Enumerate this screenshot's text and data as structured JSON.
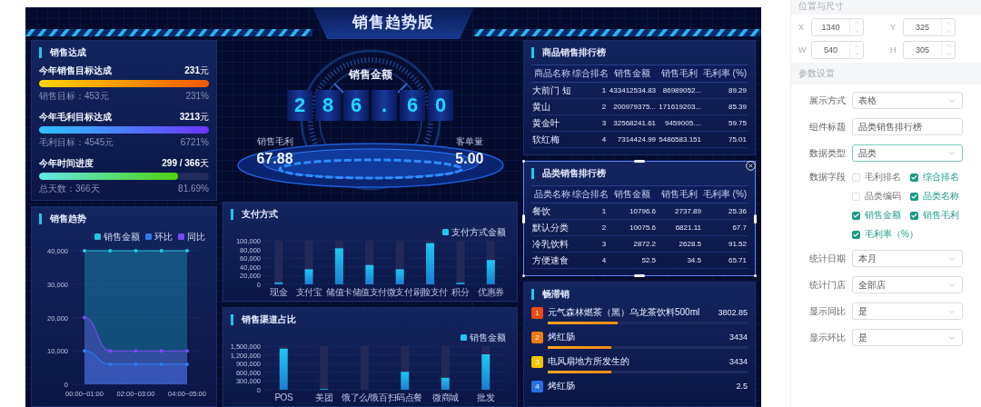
{
  "header": {
    "title": "销售趋势版"
  },
  "achievement": {
    "title": "销售达成",
    "items": [
      {
        "label": "今年销售目标达成",
        "value": "231",
        "unit": "元",
        "level": 1,
        "target": "销售目标：453元",
        "percent": "231%"
      },
      {
        "label": "今年毛利目标达成",
        "value": "3213",
        "unit": "元",
        "level": 1,
        "target": "毛利目标：4545元",
        "percent": "6721%"
      },
      {
        "label": "今年时间进度",
        "value": "299 / 366",
        "unit": "天",
        "level": 0.8169,
        "target": "总天数：366天",
        "percent": "81.69%"
      }
    ]
  },
  "trend": {
    "title": "销售趋势",
    "chart_data": {
      "type": "area",
      "categories": [
        "00:00~01:00",
        null,
        "02:00~03:00",
        null,
        "04:00~05:00"
      ],
      "grid": true,
      "legend": "upper right",
      "ylim": [
        0,
        40000
      ],
      "yticks": [
        {
          "value": 0,
          "label": "0"
        },
        {
          "value": 10000,
          "label": "10,000"
        },
        {
          "value": 20000,
          "label": "20,000"
        },
        {
          "value": 30000,
          "label": "30,000"
        },
        {
          "value": 40000,
          "label": "40,000"
        }
      ],
      "series": [
        {
          "name": "销售金额",
          "color": "#22c7e0",
          "values": [
            40000,
            40000,
            40000,
            40000,
            40000
          ]
        },
        {
          "name": "环比",
          "color": "#2a7bf0",
          "values": [
            10000,
            6000,
            6000,
            6000,
            6000
          ]
        },
        {
          "name": "同比",
          "color": "#7a4cf0",
          "values": [
            20000,
            10000,
            10000,
            10000,
            10000
          ]
        }
      ]
    }
  },
  "sales_amount": {
    "label": "销售金额",
    "digits": [
      "2",
      "8",
      "6",
      ".",
      "6",
      "0"
    ],
    "stats": [
      {
        "label": "销售毛利",
        "value": "67.88"
      },
      {
        "label": "客单量",
        "value": "5.00"
      }
    ]
  },
  "payment": {
    "title": "支付方式",
    "chart_data": {
      "type": "bar",
      "categories": [
        "现金",
        "支付宝",
        "储值卡",
        "储值支付",
        "微支付",
        "刷脸支付",
        "积分",
        "优惠券"
      ],
      "grid": true,
      "legend": "upper right",
      "ylim": [
        0,
        100000
      ],
      "yticks": [
        {
          "value": 0,
          "label": "0"
        },
        {
          "value": 20000,
          "label": "20,000"
        },
        {
          "value": 40000,
          "label": "40,000"
        },
        {
          "value": 60000,
          "label": "60,000"
        },
        {
          "value": 80000,
          "label": "80,000"
        },
        {
          "value": 100000,
          "label": "100,000"
        }
      ],
      "series": [
        {
          "name": "支付方式金额",
          "color": "#1fc8f0",
          "values": [
            5000,
            35000,
            83000,
            45000,
            35000,
            95000,
            4000,
            56000
          ]
        },
        {
          "color": "#25295a",
          "values": [
            95000,
            65000,
            17000,
            55000,
            65000,
            5000,
            96000,
            44000
          ]
        }
      ],
      "stacked": true
    }
  },
  "channels": {
    "title": "销售渠道占比",
    "chart_data": {
      "type": "bar",
      "categories": [
        "POS",
        "美团",
        "饿了么/饿百",
        "扫码点餐",
        "微商城",
        "批发"
      ],
      "grid": true,
      "legend": "upper right",
      "ylim": [
        0,
        1500000
      ],
      "yticks": [
        {
          "value": 0,
          "label": "0"
        },
        {
          "value": 300000,
          "label": "300,000"
        },
        {
          "value": 600000,
          "label": "600,000"
        },
        {
          "value": 900000,
          "label": "900,000"
        },
        {
          "value": 1200000,
          "label": "1,200,000"
        },
        {
          "value": 1500000,
          "label": "1,500,000"
        }
      ],
      "series": [
        {
          "name": "销售金额",
          "color": "#1fc8f0",
          "values": [
            1420000,
            30000,
            0,
            620000,
            420000,
            1220000
          ]
        },
        {
          "color": "#25295a",
          "values": [
            80000,
            1470000,
            1500000,
            880000,
            1080000,
            280000
          ]
        }
      ],
      "stacked": true
    }
  },
  "rankings": [
    {
      "title": "商品销售排行榜",
      "selected": false,
      "columns": [
        "商品名称",
        "综合排名",
        "销售金额",
        "销售毛利",
        "毛利率 (%)"
      ],
      "rows": [
        [
          "大前门 短",
          "1",
          "433412534.83",
          "86989052...",
          "89.29"
        ],
        [
          "黄山",
          "2",
          "200979375...",
          "171619203...",
          "85.39"
        ],
        [
          "黄金叶",
          "3",
          "32568241.61",
          "9459005....",
          "59.75"
        ],
        [
          "软红梅",
          "4",
          "7314424.99",
          "5486583.151",
          "75.01"
        ]
      ]
    },
    {
      "title": "品类销售排行榜",
      "selected": true,
      "columns": [
        "品类名称",
        "综合排名",
        "销售金额",
        "销售毛利",
        "毛利率 (%)"
      ],
      "rows": [
        [
          "餐饮",
          "1",
          "10796.6",
          "2737.89",
          "25.36"
        ],
        [
          "默认分类",
          "2",
          "10075.6",
          "6821.11",
          "67.7"
        ],
        [
          "冷乳饮料",
          "3",
          "2872.2",
          "2628.5",
          "91.52"
        ],
        [
          "方便速食",
          "4",
          "52.5",
          "34.5",
          "65.71"
        ]
      ]
    }
  ],
  "best_sellers": {
    "title": "畅滞销",
    "items": [
      {
        "rank": "1",
        "color": "#f04a0e",
        "name": "元气森林燃茶（黑）乌龙茶饮料500ml",
        "value": "3802.85",
        "level": 0.35
      },
      {
        "rank": "2",
        "color": "#f07b10",
        "name": "烤红肠",
        "value": "3434",
        "level": 0.32
      },
      {
        "rank": "3",
        "color": "#f5c400",
        "name": "电风扇地方所发生的",
        "value": "3434",
        "level": 0.32
      },
      {
        "rank": "4",
        "color": "#2a6fe0",
        "name": "烤红肠",
        "value": "2.5"
      }
    ]
  },
  "settings": {
    "top_section": "位置与尺寸",
    "position": [
      {
        "label": "X",
        "value": "1340"
      },
      {
        "label": "Y",
        "value": "325"
      },
      {
        "label": "W",
        "value": "540"
      },
      {
        "label": "H",
        "value": "305"
      }
    ],
    "section": "参数设置",
    "rows": [
      {
        "kind": "select",
        "label": "展示方式",
        "value": "表格",
        "focused": false
      },
      {
        "kind": "input",
        "label": "组件标题",
        "value": "品类销售排行榜",
        "focused": false
      },
      {
        "kind": "select",
        "label": "数据类型",
        "value": "品类",
        "focused": true
      },
      {
        "kind": "checkboxes",
        "label": "数据字段",
        "options": [
          {
            "label": "毛利排名",
            "checked": false
          },
          {
            "label": "综合排名",
            "checked": true
          },
          {
            "label": "品类编码",
            "checked": false
          },
          {
            "label": "品类名称",
            "checked": true
          },
          {
            "label": "销售金额",
            "checked": true
          },
          {
            "label": "销售毛利",
            "checked": true
          },
          {
            "label": "毛利率（%）",
            "checked": true
          }
        ]
      },
      {
        "kind": "select",
        "label": "统计日期",
        "value": "本月",
        "focused": false
      },
      {
        "kind": "select",
        "label": "统计门店",
        "value": "全部店",
        "focused": false
      },
      {
        "kind": "select",
        "label": "显示同比",
        "value": "是",
        "focused": false
      },
      {
        "kind": "select",
        "label": "显示环比",
        "value": "是",
        "focused": false
      }
    ]
  }
}
